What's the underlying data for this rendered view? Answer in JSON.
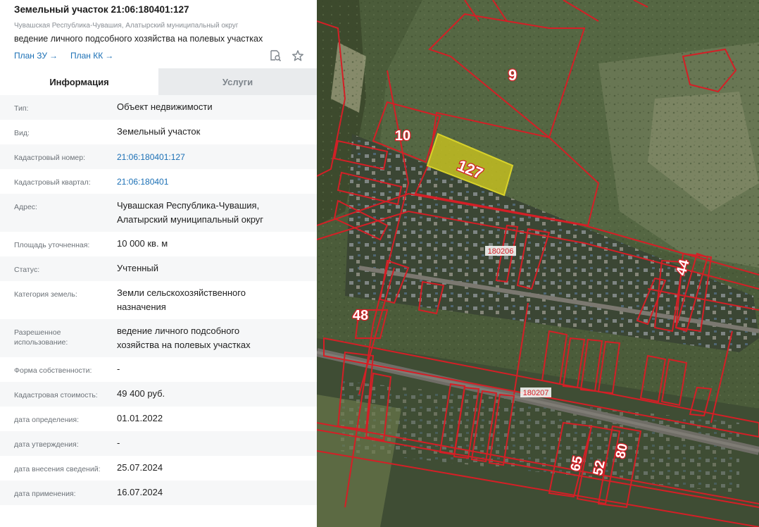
{
  "header": {
    "title": "Земельный участок 21:06:180401:127",
    "region": "Чувашская Республика-Чувашия, Алатырский муниципальный округ",
    "use": "ведение личного подсобного хозяйства на полевых участках",
    "link_plan_zu": "План ЗУ",
    "link_plan_kk": "План КК",
    "arrow": "→",
    "icons": [
      "search-document-icon",
      "star-icon"
    ]
  },
  "tabs": {
    "info": "Информация",
    "services": "Услуги"
  },
  "rows": [
    {
      "label": "Тип:",
      "value": "Объект недвижимости"
    },
    {
      "label": "Вид:",
      "value": "Земельный участок"
    },
    {
      "label": "Кадастровый номер:",
      "value": "21:06:180401:127"
    },
    {
      "label": "Кадастровый квартал:",
      "value": "21:06:180401"
    },
    {
      "label": "Адрес:",
      "value1": "Чувашская Республика-Чувашия,",
      "value2": "Алатырский муниципальный округ"
    },
    {
      "label": "Площадь уточненная:",
      "value": "10 000 кв. м"
    },
    {
      "label": "Статус:",
      "value": "Учтенный"
    },
    {
      "label": "Категория земель:",
      "value1": "Земли сельскохозяйственного",
      "value2": "назначения"
    },
    {
      "label1": "Разрешенное",
      "label2": "использование:",
      "value1": "ведение личного подсобного",
      "value2": "хозяйства на полевых участках"
    },
    {
      "label": "Форма собственности:",
      "value": "-"
    },
    {
      "label": "Кадастровая стоимость:",
      "value": "49 400 руб."
    },
    {
      "label": "дата определения:",
      "value": "01.01.2022"
    },
    {
      "label": "дата утверждения:",
      "value": "-"
    },
    {
      "label": "дата внесения сведений:",
      "value": "25.07.2024"
    },
    {
      "label": "дата применения:",
      "value": "16.07.2024"
    }
  ],
  "map": {
    "parcel_labels": [
      "9",
      "10",
      "127",
      "44",
      "48",
      "65",
      "52",
      "80"
    ],
    "quarter_labels": [
      "180206",
      "180207"
    ],
    "colors": {
      "boundary": "#d41f26",
      "selected_fill": "#c8c21e",
      "field": "#4a5e37",
      "road": "#6f6d66"
    }
  }
}
